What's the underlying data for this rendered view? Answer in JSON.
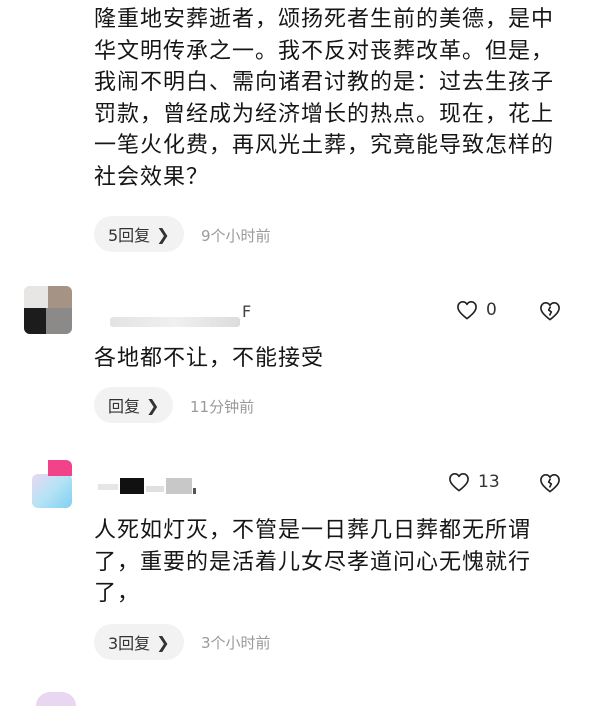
{
  "comment_top": {
    "lines": [
      "隆重地安葬逝者，颂扬死者生前的美德，是中",
      "华文明传承之一。我不反对丧葬改革。但是，",
      "我闹不明白、需向诸君讨教的是：过去生孩子",
      "罚款，曾经成为经济增长的热点。现在，花上",
      "一笔火化费，再风光土葬，究竟能导致怎样的",
      "社会效果？"
    ],
    "reply_label": "5回复",
    "time": "9个小时前"
  },
  "comment_2": {
    "name_fragment": "F",
    "like_count": "0",
    "text": "各地都不让，不能接受",
    "reply_label": "回复",
    "time": "11分钟前"
  },
  "comment_3": {
    "like_count": "13",
    "lines": [
      "人死如灯灭，不管是一日葬几日葬都无所谓",
      "了，重要的是活着儿女尽孝道问心无愧就行",
      "了，"
    ],
    "reply_label": "3回复",
    "time": "3个小时前"
  },
  "icons": {
    "like": "heart-outline-icon",
    "dislike": "broken-heart-icon",
    "chevron": "chevron-right-icon"
  }
}
